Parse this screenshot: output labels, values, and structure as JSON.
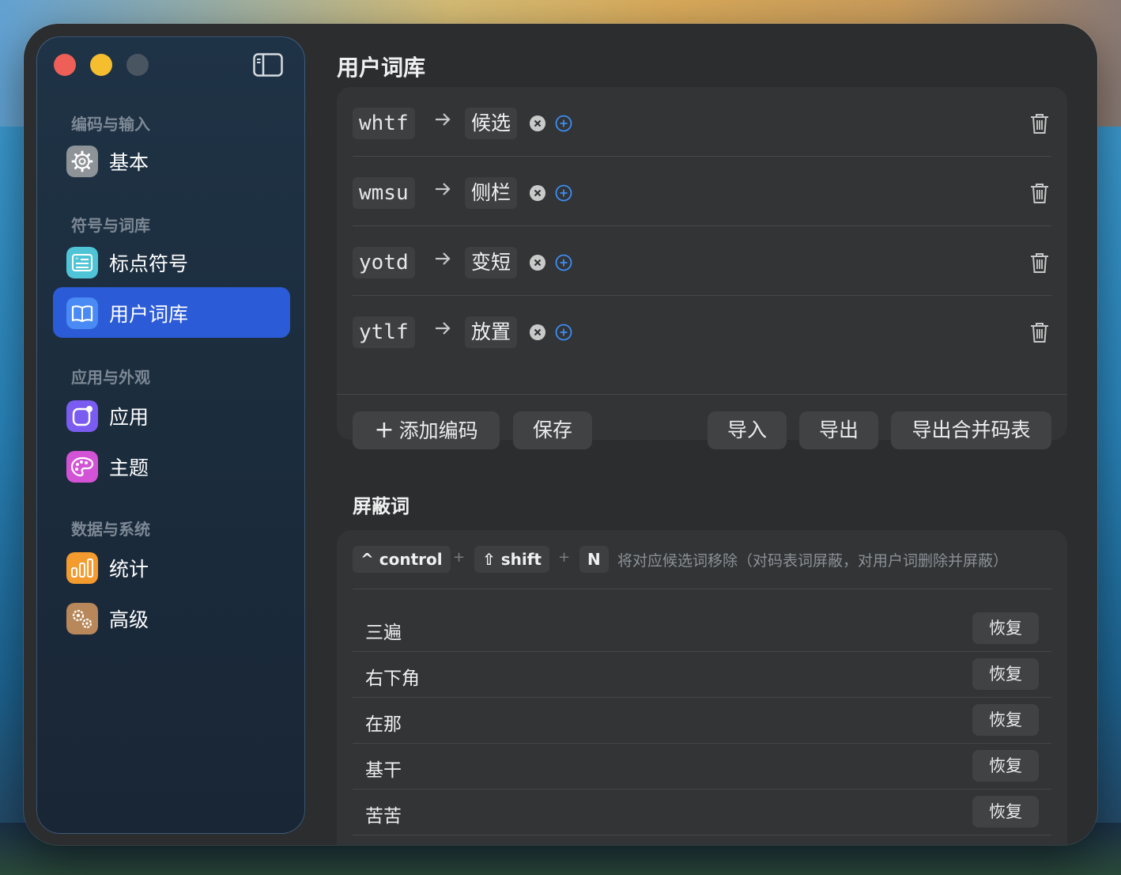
{
  "sidebar": {
    "sections": [
      {
        "label": "编码与输入"
      },
      {
        "label": "符号与词库"
      },
      {
        "label": "应用与外观"
      },
      {
        "label": "数据与系统"
      }
    ],
    "items": [
      {
        "label": "基本",
        "icon": "gear-icon"
      },
      {
        "label": "标点符号",
        "icon": "quote-list-icon"
      },
      {
        "label": "用户词库",
        "icon": "book-icon",
        "active": true
      },
      {
        "label": "应用",
        "icon": "app-badge-icon"
      },
      {
        "label": "主题",
        "icon": "palette-icon"
      },
      {
        "label": "统计",
        "icon": "bar-chart-icon"
      },
      {
        "label": "高级",
        "icon": "gears-icon"
      }
    ]
  },
  "main": {
    "title": "用户词库",
    "entries": [
      {
        "code": "whtf",
        "word": "候选"
      },
      {
        "code": "wmsu",
        "word": "侧栏"
      },
      {
        "code": "yotd",
        "word": "变短"
      },
      {
        "code": "ytlf",
        "word": "放置"
      }
    ],
    "actions": {
      "add": "添加编码",
      "save": "保存",
      "import": "导入",
      "export": "导出",
      "export_merged": "导出合并码表"
    },
    "blocked": {
      "title": "屏蔽词",
      "shortcut": {
        "key1": "control",
        "key2": "shift",
        "key3": "N",
        "plus": "+"
      },
      "hint": "将对应候选词移除（对码表词屏蔽，对用户词删除并屏蔽）",
      "restore_label": "恢复",
      "words": [
        "三遍",
        "右下角",
        "在那",
        "基干",
        "苦苦"
      ]
    }
  },
  "colors": {
    "accent": "#2b5bd6",
    "window_bg": "#2c2d2f",
    "card_bg": "#323435",
    "plus_icon": "#3d8ef7"
  }
}
